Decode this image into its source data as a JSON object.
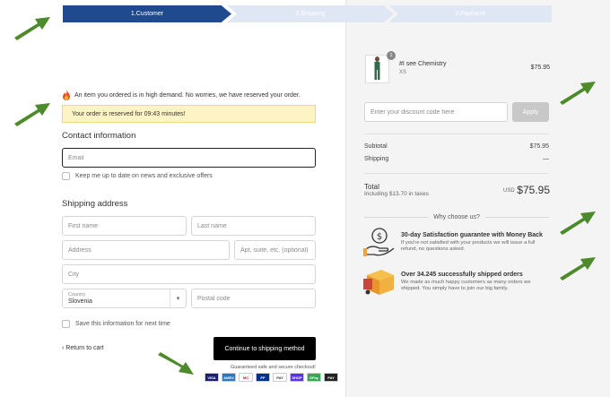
{
  "steps": [
    "1.Customer",
    "2.Shipping",
    "3.Payment"
  ],
  "notice": {
    "demand": "An item you ordered is in high demand. No worries, we have reserved your order.",
    "reserved": "Your order is reserved for 09:43 minutes!"
  },
  "contact": {
    "title": "Contact information",
    "email_placeholder": "Email",
    "newsletter": "Keep me up to date on news and exclusive offers"
  },
  "shipping": {
    "title": "Shipping address",
    "first_name": "First name",
    "last_name": "Last name",
    "address": "Address",
    "apt": "Apt, suite, etc. (optional)",
    "city": "City",
    "country_label": "Country",
    "country_value": "Slovenia",
    "postal": "Postal code",
    "save_info": "Save this information for next time"
  },
  "nav": {
    "return": "Return to cart",
    "continue": "Continue to shipping method",
    "guarantee": "Guaranteed safe and secure checkout!"
  },
  "payment_cards": [
    "VISA",
    "AMEX",
    "MC",
    "PP",
    "PAY",
    "SHOP",
    "GPay",
    "PAY"
  ],
  "order": {
    "qty": "1",
    "product_name": "#I see Chemistry",
    "product_size": "XS",
    "product_price": "$75.95",
    "discount_placeholder": "Enter your discount code here",
    "apply": "Apply",
    "subtotal_label": "Subtotal",
    "subtotal_value": "$75.95",
    "shipping_label": "Shipping",
    "shipping_value": "—",
    "total_label": "Total",
    "total_tax": "Including $13.70 in taxes",
    "currency": "USD",
    "total_value": "$75.95"
  },
  "why": {
    "title": "Why choose us?",
    "benefits": [
      {
        "title": "30-day Satisfaction guarantee with Money Back",
        "text": "If you're not satisfied with your products we will issue a full refund, no questions asked."
      },
      {
        "title": "Over 34.245 successfully shipped orders",
        "text": "We made as much happy customers as many orders we shipped. You simply have to join our big family."
      }
    ]
  },
  "colors": {
    "step_active": "#1f4b8e",
    "step_inactive": "#dfe7f4",
    "arrow": "#4c8a2b",
    "notice_bg": "#fdf4c6"
  }
}
